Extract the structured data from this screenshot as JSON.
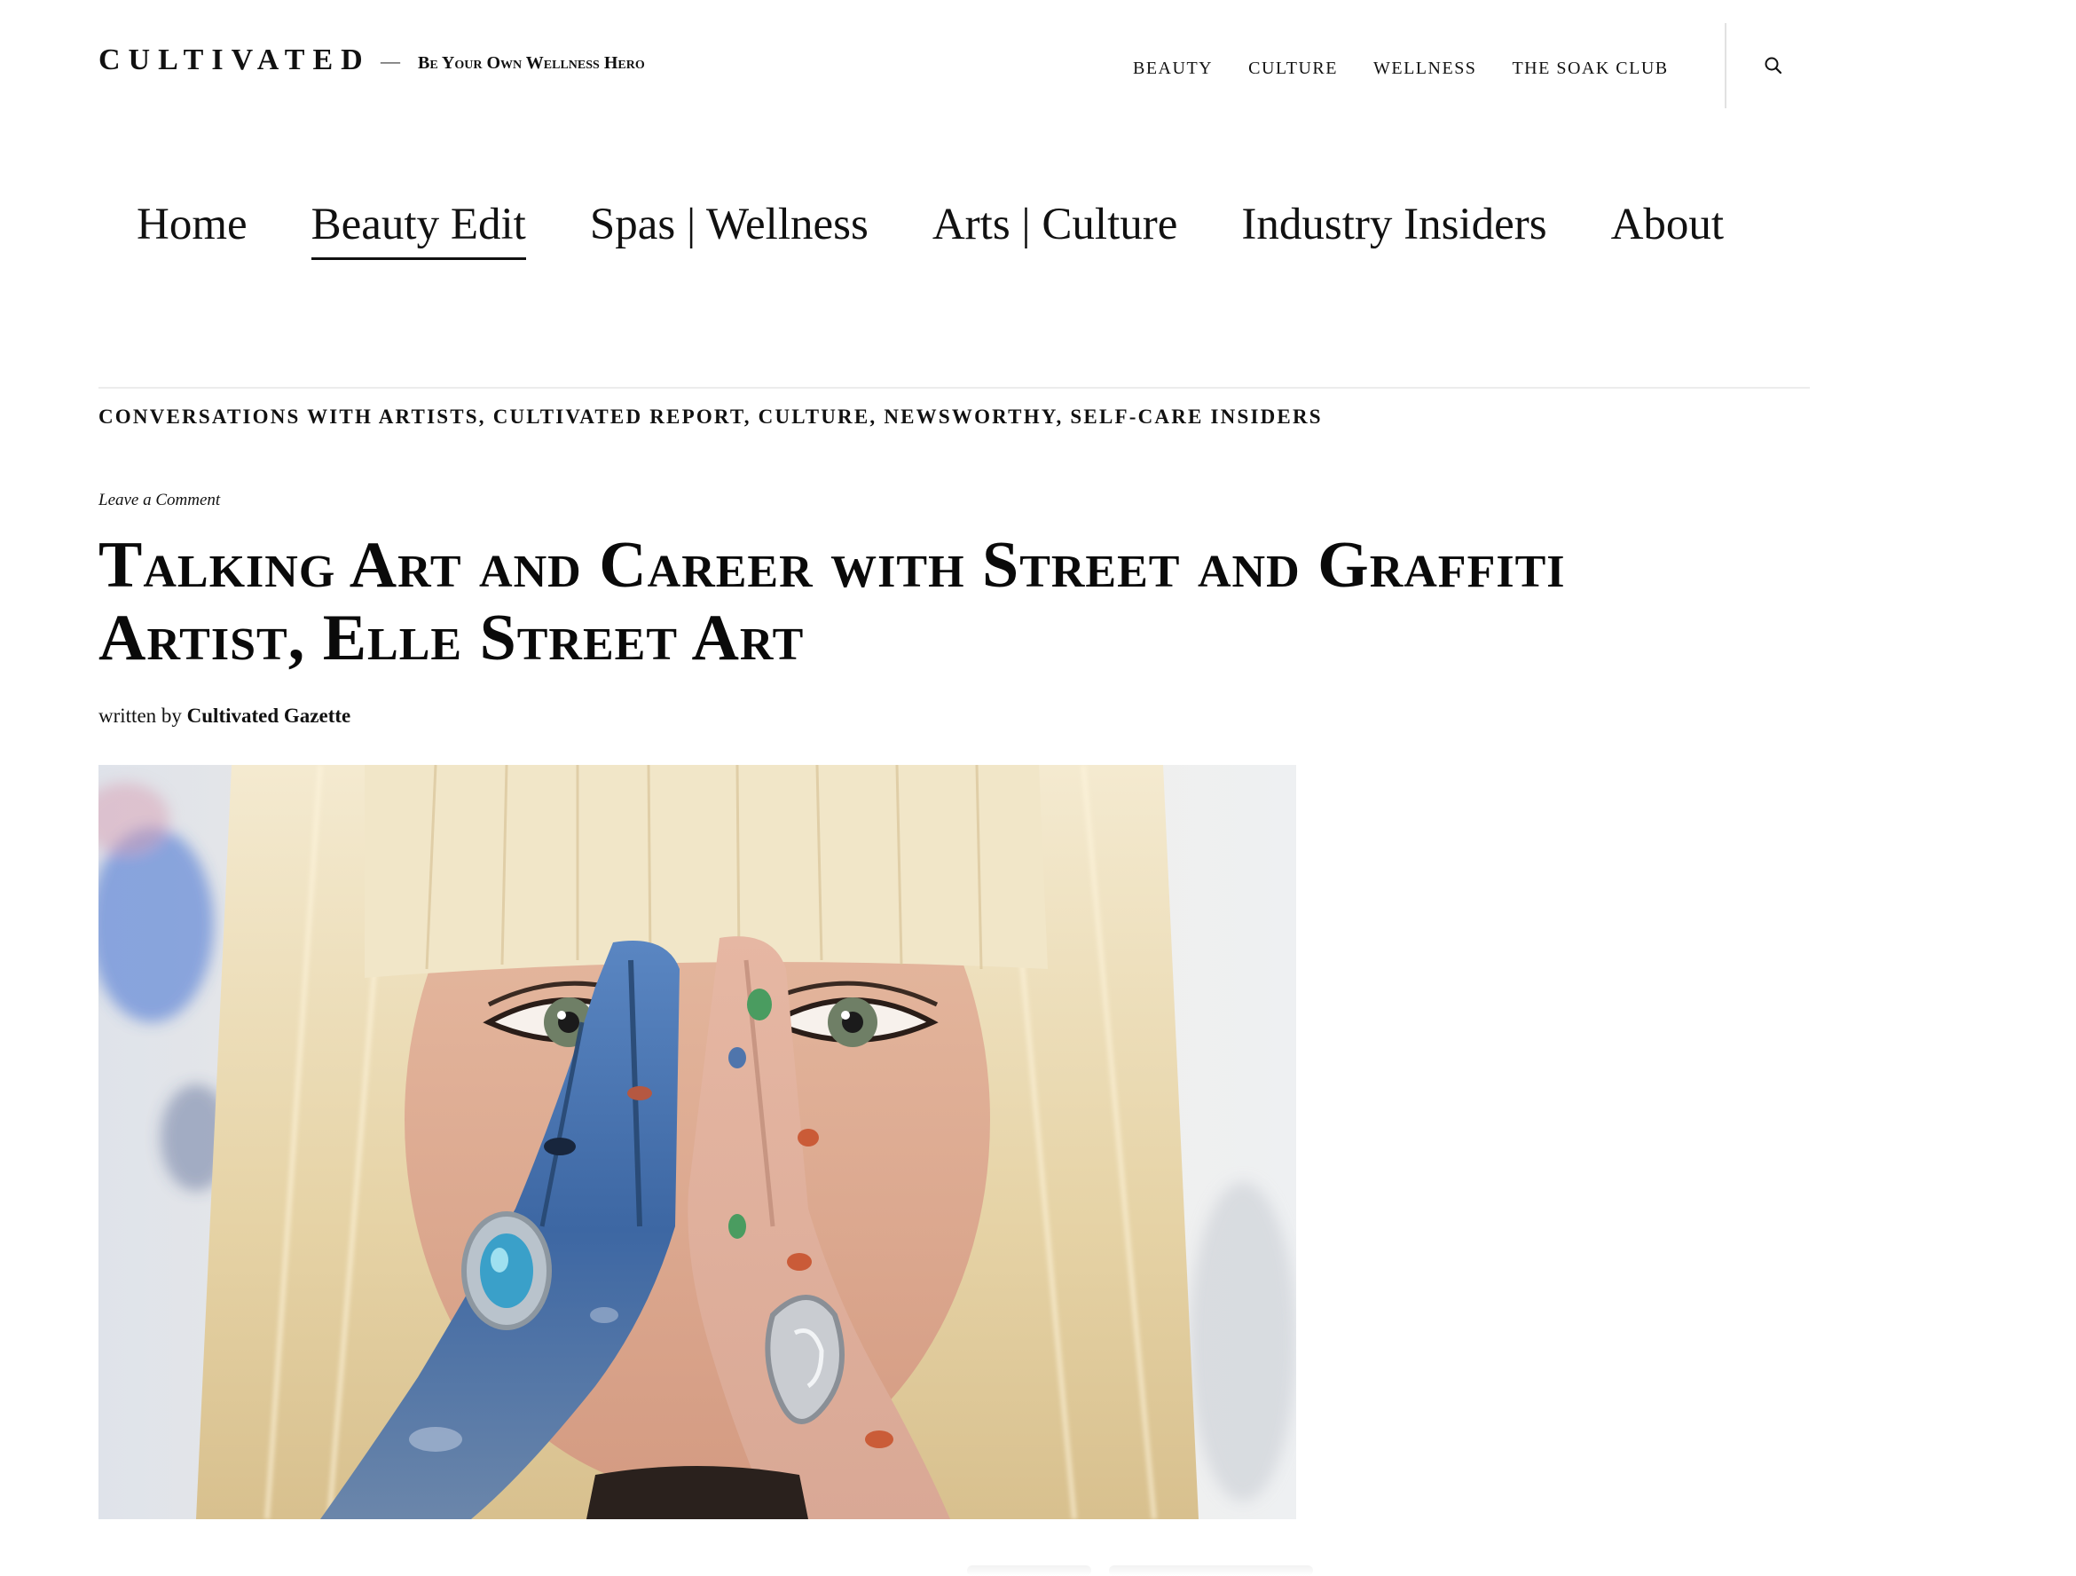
{
  "site": {
    "brand": "CULTIVATED",
    "dash": "—",
    "tagline": "Be Your Own Wellness Hero"
  },
  "top_nav": [
    "BEAUTY",
    "CULTURE",
    "WELLNESS",
    "THE SOAK CLUB"
  ],
  "search_icon": "search-icon",
  "main_nav": {
    "items": [
      "Home",
      "Beauty Edit",
      "Spas | Wellness",
      "Arts | Culture",
      "Industry Insiders",
      "About"
    ],
    "active": "Beauty Edit"
  },
  "article": {
    "categories": [
      "CONVERSATIONS WITH ARTISTS",
      "CULTIVATED REPORT",
      "CULTURE",
      "NEWSWORTHY",
      "SELF-CARE INSIDERS"
    ],
    "comment_link": "Leave a Comment",
    "title": "Talking Art and Career with Street and Graffiti Artist, Elle Street Art",
    "byline_prefix": "written by",
    "author": "Cultivated Gazette",
    "image_description_icon": "photo-woman-paint-covered-hands"
  },
  "colors": {
    "text": "#111111",
    "rule": "#ececec",
    "hair": "#eadcb8",
    "paint_blue": "#3f6fae",
    "paint_red": "#c8532e",
    "paint_green": "#3a9a5a"
  }
}
